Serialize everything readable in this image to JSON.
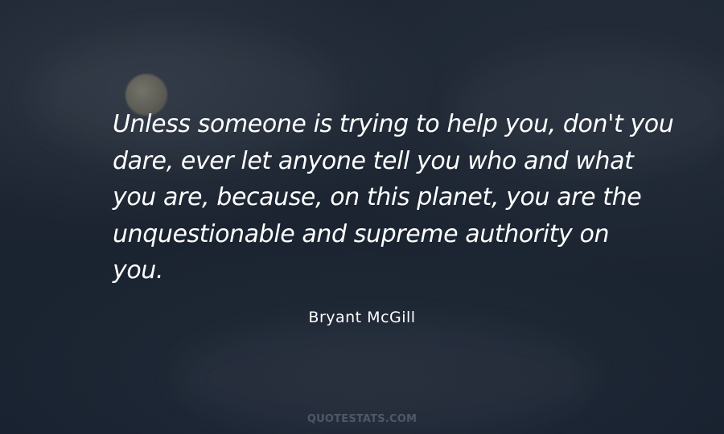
{
  "quote": {
    "lines": [
      "Unless someone is trying to help you, don't you",
      "dare, ever let anyone tell you who and what",
      "you are, because, on this planet, you are the",
      "unquestionable and supreme authority on",
      "you."
    ]
  },
  "author": "Bryant McGill",
  "watermark": "QUOTESTATS.COM"
}
